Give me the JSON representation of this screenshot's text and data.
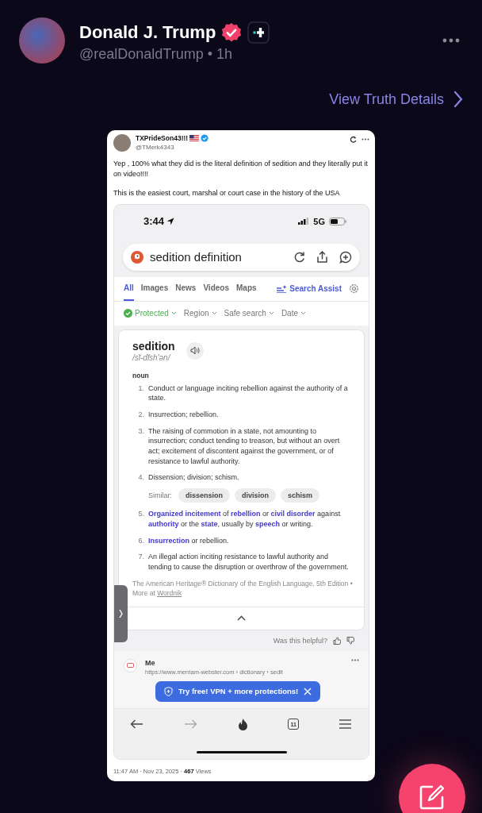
{
  "author": {
    "name": "Donald J. Trump",
    "handle": "@realDonaldTrump • 1h"
  },
  "view_details": "View Truth Details",
  "embed": {
    "author": {
      "name": "TXPrideSon43!!!",
      "handle": "@TMerk4343"
    },
    "paragraphs": [
      "Yep , 100% what they did is the literal definition of sedition and they literally put it on video!!!!",
      "This is the easiest court, marshal or court case in the history of the USA"
    ],
    "screenshot": {
      "status": {
        "time": "3:44",
        "network": "5G"
      },
      "search": {
        "value": "sedition definition"
      },
      "tabs": [
        {
          "label": "All",
          "selected": true
        },
        {
          "label": "Images",
          "selected": false
        },
        {
          "label": "News",
          "selected": false
        },
        {
          "label": "Videos",
          "selected": false
        },
        {
          "label": "Maps",
          "selected": false
        }
      ],
      "assist": "Search Assist",
      "filters": [
        {
          "kind": "status",
          "label": "Protected"
        },
        {
          "kind": "dropdown",
          "label": "Region"
        },
        {
          "kind": "dropdown",
          "label": "Safe search"
        },
        {
          "kind": "dropdown",
          "label": "Date"
        }
      ],
      "definition": {
        "word": "sedition",
        "pronunciation": "/sĭ-dĭsh′ən/",
        "part_of_speech": "noun",
        "senses": [
          {
            "number": "1.",
            "text": "Conduct or language inciting rebellion against the authority of a state."
          },
          {
            "number": "2.",
            "text": "Insurrection; rebellion."
          },
          {
            "number": "3.",
            "text": "The raising of commotion in a state, not amounting to insurrection; conduct tending to treason, but without an overt act; excitement of discontent against the government, or of resistance to lawful authority."
          },
          {
            "number": "4.",
            "text": "Dissension; division; schism.",
            "similar_label": "Similar:",
            "similar": [
              "dissension",
              "division",
              "schism"
            ]
          },
          {
            "number": "5.",
            "text": "**Organized incitement** of **rebellion** or **civil disorder** against **authority** or the **state**, usually by **speech** or writing."
          },
          {
            "number": "6.",
            "text": "**Insurrection** or rebellion."
          },
          {
            "number": "7.",
            "text": "An illegal action inciting resistance to lawful authority and tending to cause the disruption or overthrow of the government."
          }
        ],
        "source": "The American Heritage® Dictionary of the English Language, 5th Edition •  More at",
        "source_link": "Wordnik"
      },
      "helpful": "Was this helpful?",
      "result": {
        "title": "Me",
        "url": "https://www.merriam-webster.com › dictionary › sedit"
      },
      "banner": "Try free! VPN + more protections!",
      "tab_count": "11"
    },
    "footer": "11:47 AM · Nov 23, 2025 · **467** Views"
  }
}
